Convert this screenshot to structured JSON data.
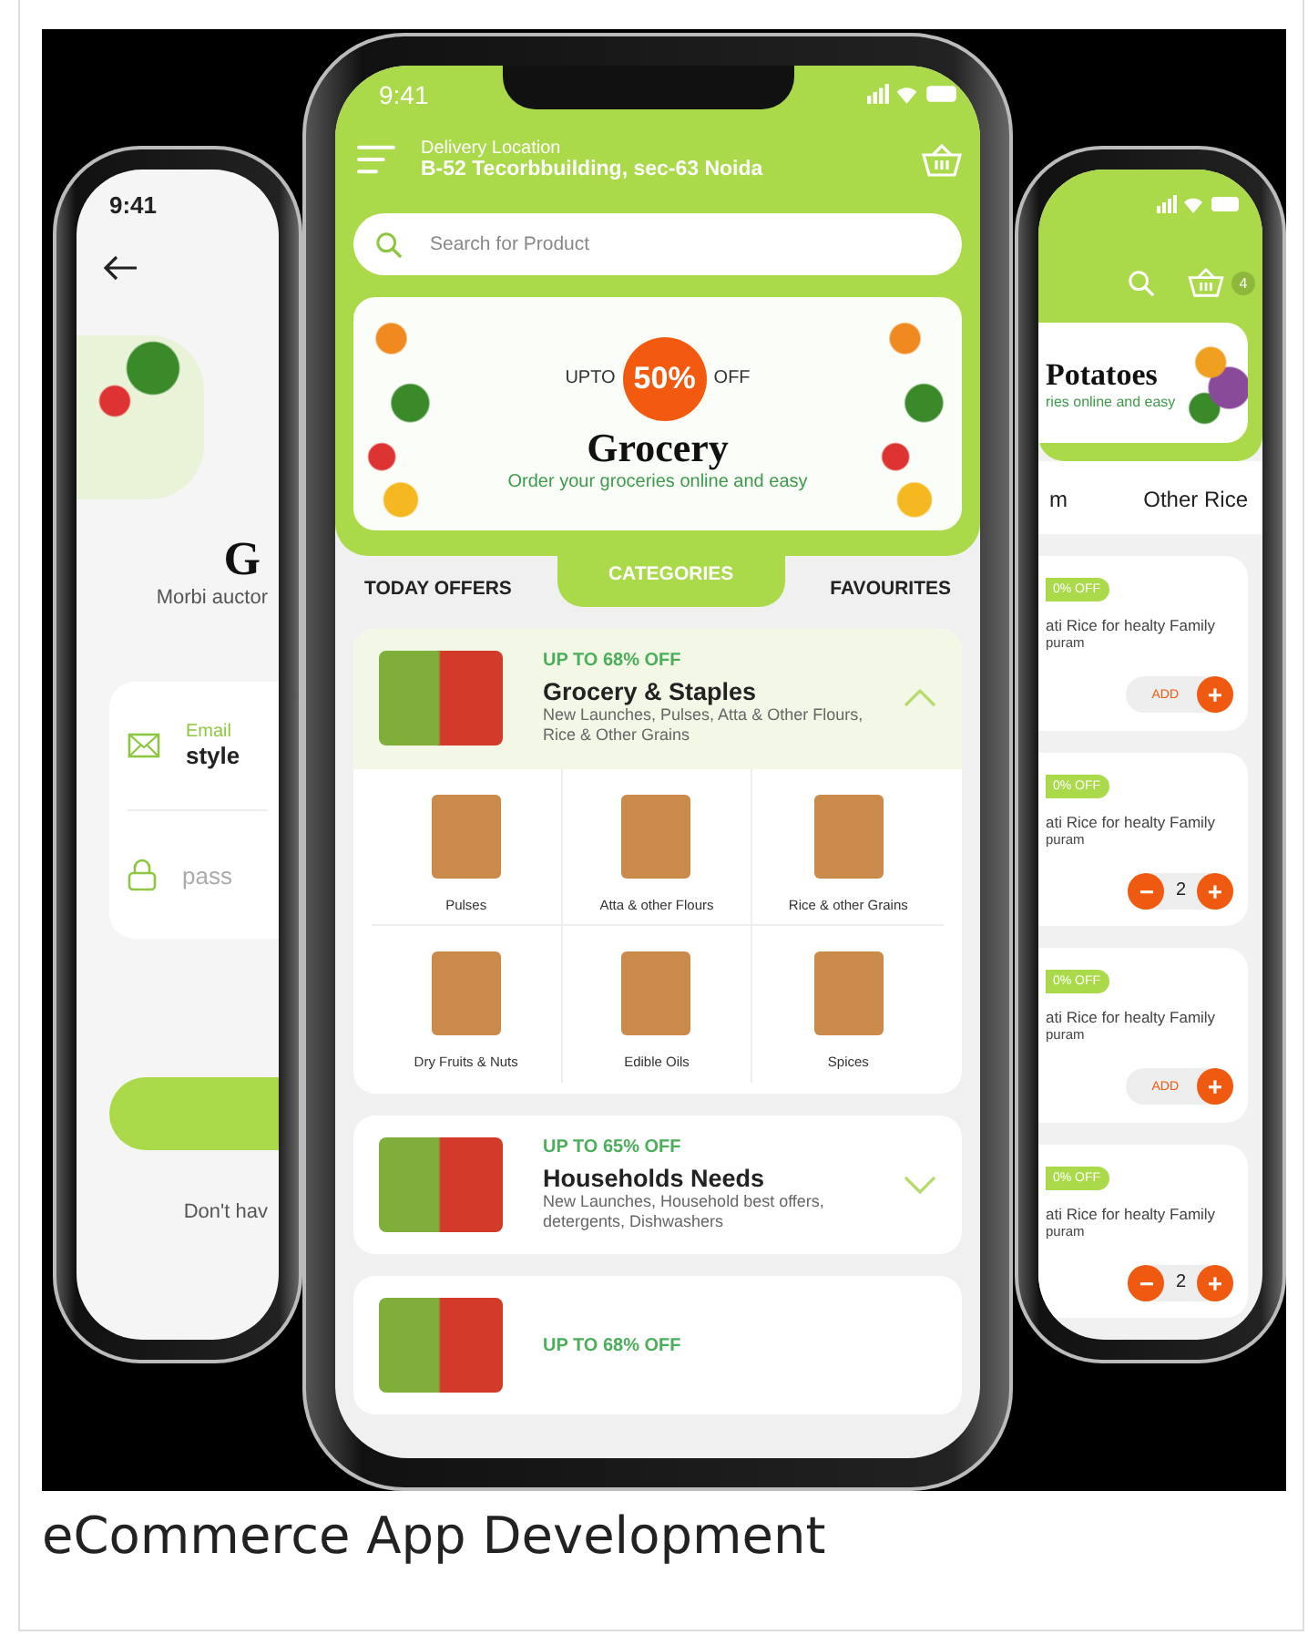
{
  "left_phone": {
    "status_time": "9:41",
    "title": "G",
    "subtitle": "Morbi auctor",
    "fields": [
      {
        "kind": "email",
        "label": "Email",
        "value": "style"
      },
      {
        "kind": "password",
        "placeholder": "pass"
      }
    ],
    "footer": "Don't hav"
  },
  "center_phone": {
    "status_time": "9:41",
    "delivery_label": "Delivery Location",
    "delivery_address": "B-52 Tecorbbuilding, sec-63 Noida",
    "search": {
      "placeholder": "Search for Product"
    },
    "banner": {
      "prefix": "UPTO",
      "discount": "50%",
      "suffix": "OFF",
      "title": "Grocery",
      "subtitle": "Order your groceries online and easy"
    },
    "tabs": [
      {
        "label": "TODAY OFFERS",
        "selected": false
      },
      {
        "label": "CATEGORIES",
        "selected": true
      },
      {
        "label": "FAVOURITES",
        "selected": false
      }
    ],
    "categories": [
      {
        "offer": "UP TO 68% OFF",
        "title": "Grocery & Staples",
        "description": "New Launches, Pulses, Atta &  Other Flours, Rice & Other Grains",
        "expanded": true,
        "subcategories": [
          {
            "label": "Pulses"
          },
          {
            "label": "Atta & other Flours"
          },
          {
            "label": "Rice & other Grains"
          },
          {
            "label": "Dry Fruits & Nuts"
          },
          {
            "label": "Edible Oils"
          },
          {
            "label": "Spices"
          }
        ]
      },
      {
        "offer": "UP TO 65% OFF",
        "title": "Households Needs",
        "description": "New Launches, Household best offers, detergents, Dishwashers",
        "expanded": false
      },
      {
        "offer": "UP TO 68% OFF"
      }
    ]
  },
  "right_phone": {
    "cart_count": "4",
    "banner": {
      "title": "Potatoes",
      "subtitle": "ries online and easy"
    },
    "tabs": [
      {
        "label": "m"
      },
      {
        "label": "Other Rice"
      }
    ],
    "products": [
      {
        "discount": "0% OFF",
        "name": "ati Rice for healty Family",
        "vendor": "puram",
        "in_cart": false,
        "action": "ADD",
        "increment": "+"
      },
      {
        "discount": "0% OFF",
        "name": "ati Rice for healty Family",
        "vendor": "puram",
        "in_cart": true,
        "decrement": "−",
        "quantity": "2",
        "increment": "+"
      },
      {
        "discount": "0% OFF",
        "name": "ati Rice for healty Family",
        "vendor": "puram",
        "in_cart": false,
        "action": "ADD",
        "increment": "+"
      },
      {
        "discount": "0% OFF",
        "name": "ati Rice for healty Family",
        "vendor": "puram",
        "in_cart": true,
        "decrement": "−",
        "quantity": "2",
        "increment": "+"
      }
    ]
  },
  "caption": "eCommerce App Development"
}
